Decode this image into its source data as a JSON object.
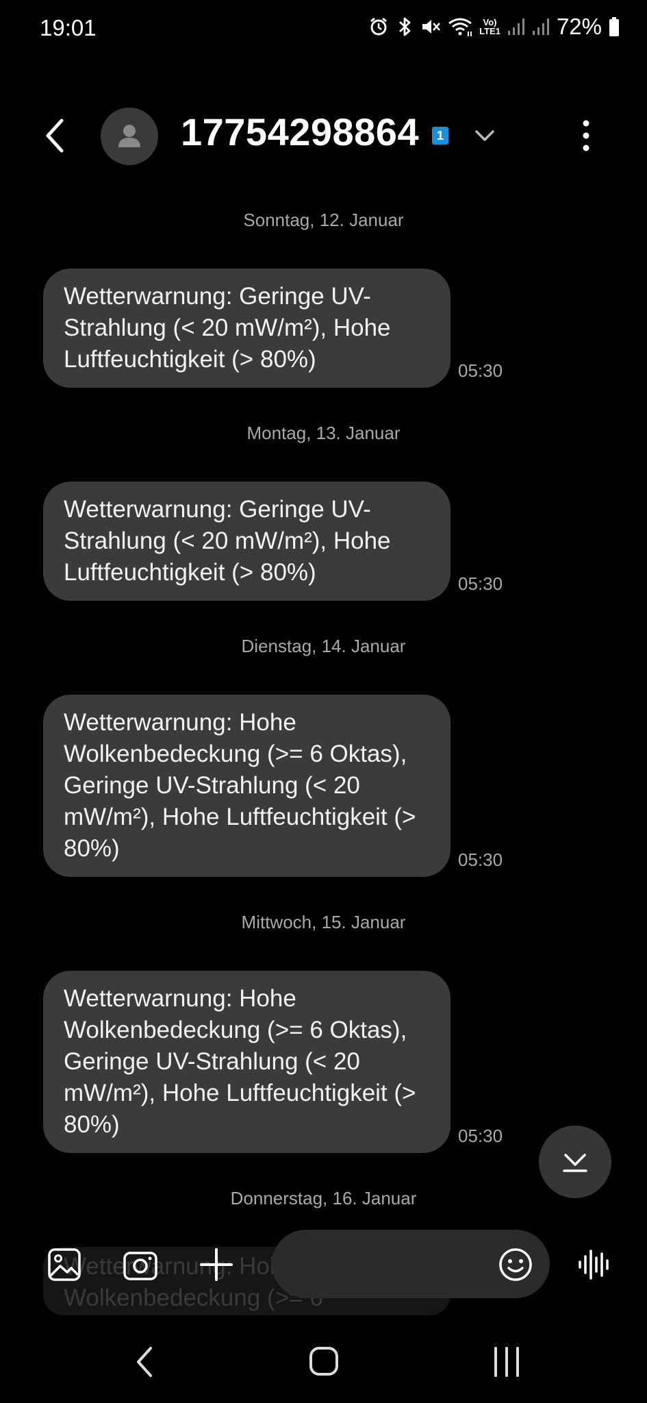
{
  "status_bar": {
    "time": "19:01",
    "battery": "72%",
    "icons": [
      "alarm-icon",
      "bluetooth-icon",
      "mute-icon",
      "wifi-icon",
      "volte-icon",
      "signal-icon",
      "signal-icon",
      "battery-icon"
    ],
    "volte_label_top": "Vo)",
    "volte_label_bottom": "LTE1"
  },
  "header": {
    "contact": "17754298864",
    "sim_badge": "1"
  },
  "messages": [
    {
      "date": "Sonntag, 12. Januar",
      "text": "Wetterwarnung: Geringe UV-Strahlung (< 20 mW/m²), Hohe Luftfeuchtigkeit (> 80%)",
      "time": "05:30"
    },
    {
      "date": "Montag, 13. Januar",
      "text": "Wetterwarnung: Geringe UV-Strahlung (< 20 mW/m²), Hohe Luftfeuchtigkeit (> 80%)",
      "time": "05:30"
    },
    {
      "date": "Dienstag, 14. Januar",
      "text": "Wetterwarnung: Hohe Wolkenbedeckung (>= 6 Oktas), Geringe UV-Strahlung (< 20 mW/m²), Hohe Luftfeuchtigkeit (> 80%)",
      "time": "05:30"
    },
    {
      "date": "Mittwoch, 15. Januar",
      "text": "Wetterwarnung: Hohe Wolkenbedeckung (>= 6 Oktas), Geringe UV-Strahlung (< 20 mW/m²), Hohe Luftfeuchtigkeit (> 80%)",
      "time": "05:30"
    }
  ],
  "next_date": "Donnerstag, 16. Januar",
  "ghost_text": "Wetterwarnung: Hohe Wolkenbedeckung (>= 6",
  "colors": {
    "background": "#000000",
    "bubble": "#3b3b3b",
    "secondary_text": "#a9a9a9",
    "sim_badge": "#1d8ed8"
  }
}
